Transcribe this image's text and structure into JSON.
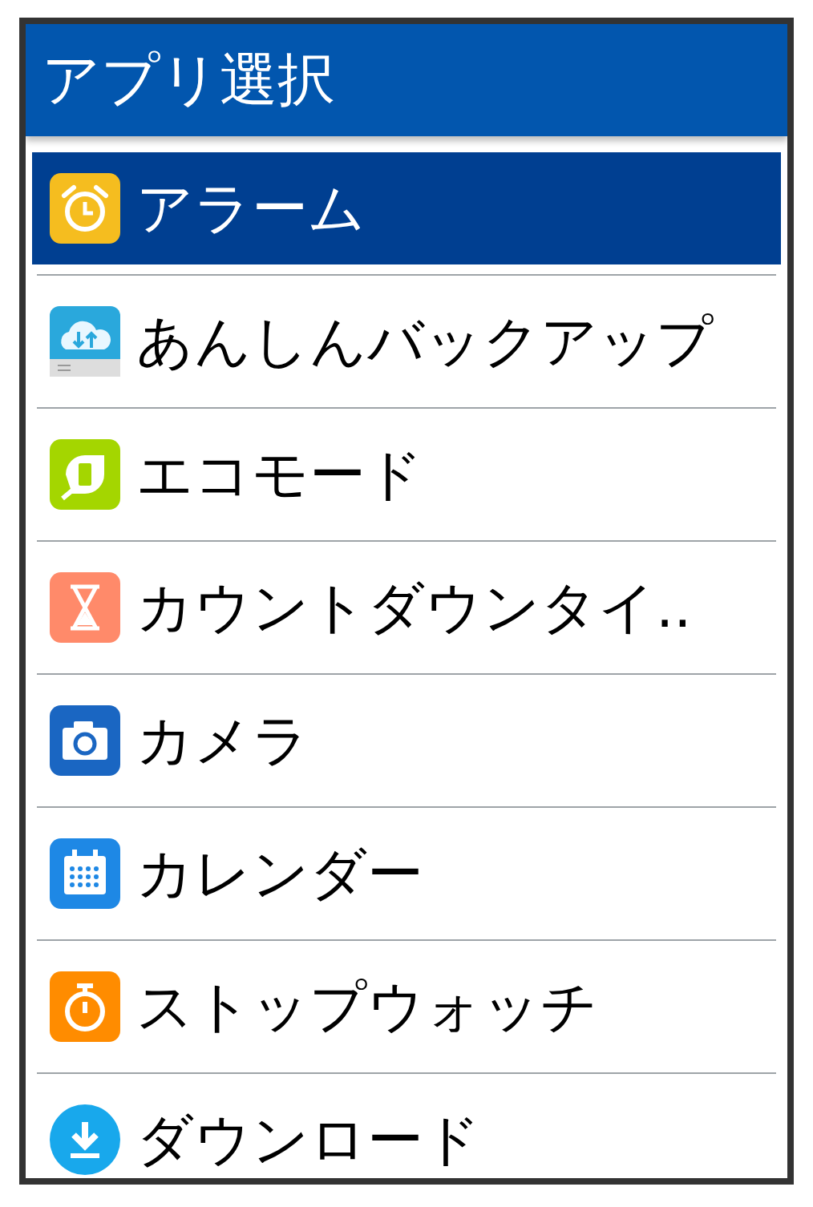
{
  "header": {
    "title": "アプリ選択"
  },
  "apps": [
    {
      "label": "アラーム",
      "selected": true
    },
    {
      "label": "あんしんバックアップ",
      "selected": false
    },
    {
      "label": "エコモード",
      "selected": false
    },
    {
      "label": "カウントダウンタイ..",
      "selected": false
    },
    {
      "label": "カメラ",
      "selected": false
    },
    {
      "label": "カレンダー",
      "selected": false
    },
    {
      "label": "ストップウォッチ",
      "selected": false
    },
    {
      "label": "ダウンロード",
      "selected": false
    }
  ]
}
